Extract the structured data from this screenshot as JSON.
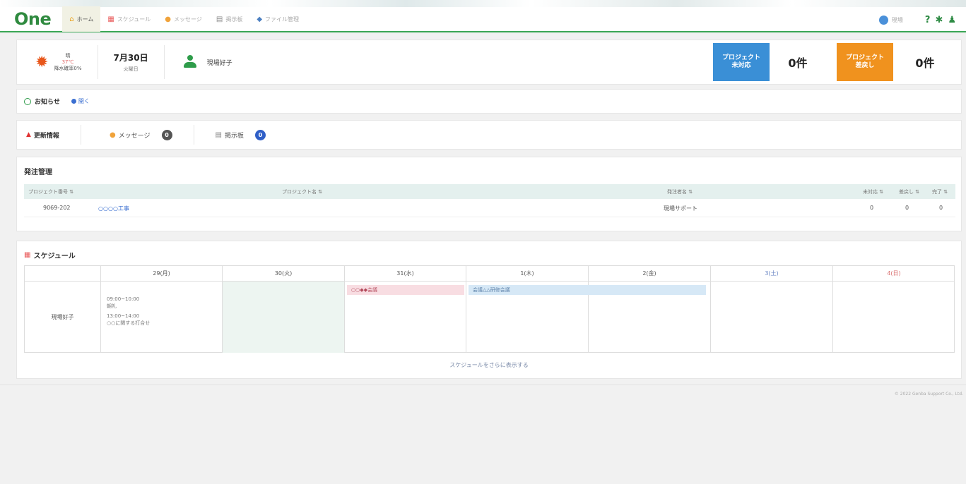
{
  "header": {
    "logo": "One",
    "nav": [
      {
        "label": "ホーム",
        "icon": "home-icon"
      },
      {
        "label": "スケジュール",
        "icon": "calendar-icon"
      },
      {
        "label": "メッセージ",
        "icon": "message-icon"
      },
      {
        "label": "掲示板",
        "icon": "board-icon"
      },
      {
        "label": "ファイル管理",
        "icon": "file-icon"
      }
    ],
    "user": "現場",
    "icons": [
      "help-icon",
      "gear-icon",
      "user-icon"
    ]
  },
  "top": {
    "weather": {
      "condition": "晴",
      "temp": "37℃",
      "rain": "降水確率0%"
    },
    "date": {
      "main": "7月30日",
      "weekday": "火曜日"
    },
    "person": "現場好子",
    "project_unhandled": {
      "label_line1": "プロジェクト",
      "label_line2": "未対応",
      "count": "0件",
      "color": "#3a8fd6"
    },
    "project_returned": {
      "label_line1": "プロジェクト",
      "label_line2": "差戻し",
      "count": "0件",
      "color": "#f0921e"
    }
  },
  "notice": {
    "title": "お知らせ",
    "link": "開く"
  },
  "updates": {
    "title": "更新情報",
    "message_label": "メッセージ",
    "message_count": "0",
    "board_label": "掲示板",
    "board_count": "0"
  },
  "orders": {
    "title": "発注管理",
    "columns": [
      "プロジェクト番号 ⇅",
      "プロジェクト名 ⇅",
      "発注者名 ⇅",
      "未対応 ⇅",
      "差戻し ⇅",
      "完了 ⇅"
    ],
    "rows": [
      {
        "number": "9069-202",
        "name": "○○○○工事",
        "client": "現場サポート",
        "unhandled": "0",
        "returned": "0",
        "done": "0"
      }
    ]
  },
  "schedule": {
    "title": "スケジュール",
    "days": [
      "29(月)",
      "30(火)",
      "31(水)",
      "1(木)",
      "2(金)",
      "3(土)",
      "4(日)"
    ],
    "person": "現場好子",
    "events_mon": [
      {
        "time": "09:00~10:00",
        "title": "朝礼"
      },
      {
        "time": "13:00~14:00",
        "title": "○○に関する打合せ"
      }
    ],
    "event_wed": "○○◆◆会議",
    "event_thu": "会議△△研修会議",
    "more": "スケジュールをさらに表示する"
  },
  "footer": {
    "copyright": "© 2022 Genba Support Co., Ltd."
  }
}
